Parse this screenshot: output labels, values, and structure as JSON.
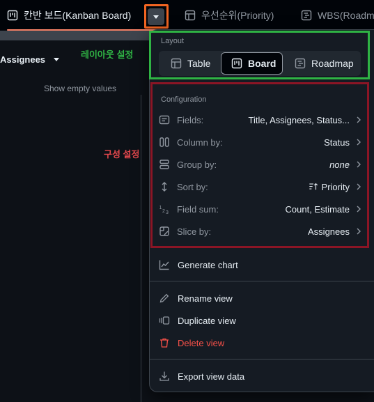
{
  "tabs": [
    {
      "label": "칸반 보드(Kanban Board)",
      "active": true
    },
    {
      "label": "우선순위(Priority)",
      "active": false
    },
    {
      "label": "WBS(Roadma",
      "active": false
    }
  ],
  "board": {
    "column_header": "Assignees",
    "show_empty": "Show empty values"
  },
  "annotations": {
    "layout": "레이아웃 설정",
    "config": "구성 설정"
  },
  "menu": {
    "layout_title": "Layout",
    "layout_options": [
      "Table",
      "Board",
      "Roadmap"
    ],
    "selected_layout": "Board",
    "config_title": "Configuration",
    "config_rows": [
      {
        "label": "Fields:",
        "value": "Title, Assignees, Status..."
      },
      {
        "label": "Column by:",
        "value": "Status"
      },
      {
        "label": "Group by:",
        "value": "none"
      },
      {
        "label": "Sort by:",
        "value": "Priority"
      },
      {
        "label": "Field sum:",
        "value": "Count, Estimate"
      },
      {
        "label": "Slice by:",
        "value": "Assignees"
      }
    ],
    "generate_chart": "Generate chart",
    "rename_view": "Rename view",
    "duplicate_view": "Duplicate view",
    "delete_view": "Delete view",
    "export_view": "Export view data"
  },
  "colors": {
    "accent_underline": "#f78166",
    "highlight_orange": "#f26522",
    "highlight_green": "#2fb344",
    "highlight_red": "#8b1525",
    "danger": "#f85149"
  }
}
